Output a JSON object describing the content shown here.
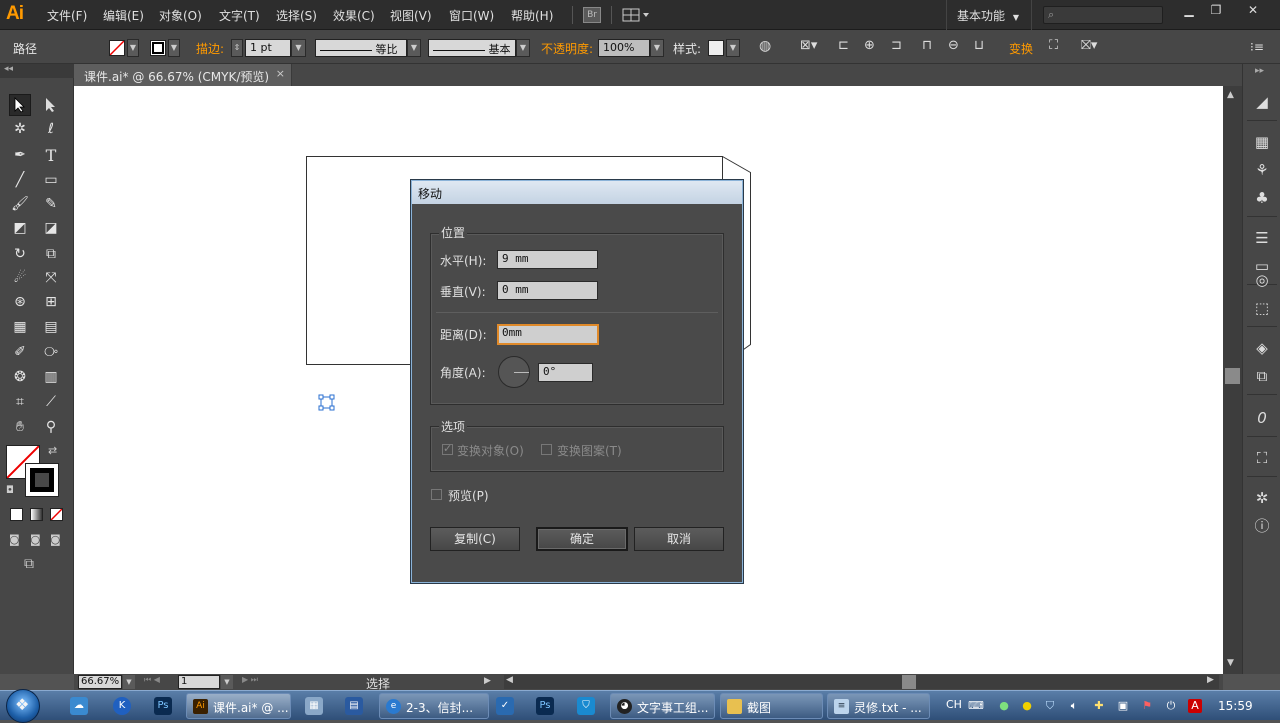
{
  "app": {
    "logo": "Ai"
  },
  "menubar": {
    "items": [
      "文件(F)",
      "编辑(E)",
      "对象(O)",
      "文字(T)",
      "选择(S)",
      "效果(C)",
      "视图(V)",
      "窗口(W)",
      "帮助(H)"
    ],
    "bridge_label": "Br",
    "workspace": "基本功能",
    "search_placeholder": ""
  },
  "controlbar": {
    "object_type": "路径",
    "stroke_label": "描边:",
    "stroke_weight": "1 pt",
    "stroke_profile": "等比",
    "brush": "基本",
    "opacity_label": "不透明度:",
    "opacity_value": "100%",
    "style_label": "样式:",
    "transform_label": "变换"
  },
  "document_tab": {
    "title": "课件.ai* @ 66.67% (CMYK/预览)",
    "close": "×"
  },
  "statusbar": {
    "zoom": "66.67%",
    "page": "1",
    "status": "选择"
  },
  "dialog": {
    "title": "移动",
    "position_group": "位置",
    "horizontal_label": "水平(H):",
    "horizontal_value": "9 mm",
    "vertical_label": "垂直(V):",
    "vertical_value": "0 mm",
    "distance_label": "距离(D):",
    "distance_value": "0mm",
    "angle_label": "角度(A):",
    "angle_value": "0°",
    "options_group": "选项",
    "transform_objects": "变换对象(O)",
    "transform_objects_checked": true,
    "transform_patterns": "变换图案(T)",
    "transform_patterns_checked": false,
    "preview": "预览(P)",
    "preview_checked": false,
    "copy_button": "复制(C)",
    "ok_button": "确定",
    "cancel_button": "取消"
  },
  "taskbar": {
    "tasks": [
      {
        "label": "课件.ai* @ ...",
        "icon": "Ai",
        "active": true
      },
      {
        "label": "2-3、信封...",
        "icon": "IE",
        "active": false
      },
      {
        "label": "文字事工组...",
        "icon": "QQ",
        "active": false
      },
      {
        "label": "截图",
        "icon": "folder",
        "active": false
      },
      {
        "label": "灵修.txt - ...",
        "icon": "notepad",
        "active": false
      }
    ],
    "lang": "CH",
    "clock": "15:59"
  },
  "colors": {
    "accent": "#ff9a00",
    "ui_bg": "#474747",
    "dialog_bg": "#4a4a4a",
    "focus": "#e08a2a"
  }
}
